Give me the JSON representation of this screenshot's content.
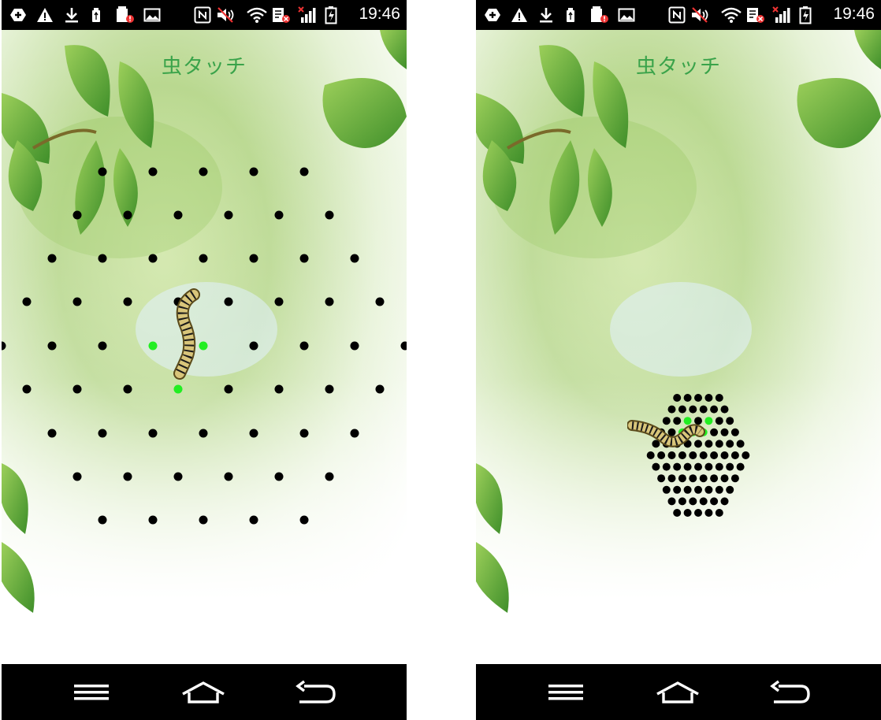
{
  "status_bar": {
    "time": "19:46",
    "icons": [
      "add-icon",
      "warning-icon",
      "download-icon",
      "usb-icon",
      "sd-card-alert-icon",
      "image-icon",
      "nfc-icon",
      "mute-icon",
      "wifi-icon",
      "sim-error-icon",
      "signal-icon",
      "battery-charging-icon"
    ]
  },
  "screens": [
    {
      "app_title": "虫タッチ",
      "grid": "large triangular dot grid",
      "green_dots": 3
    },
    {
      "app_title": "虫タッチ",
      "grid": "small hexagonal dot grid",
      "green_dots": 5
    }
  ],
  "nav_bar": {
    "icons": [
      "menu-icon",
      "home-icon",
      "back-icon"
    ]
  },
  "colors": {
    "title_green": "#3aa34a",
    "dot_black": "#000000",
    "dot_green": "#22ee22",
    "bar_black": "#000000"
  }
}
